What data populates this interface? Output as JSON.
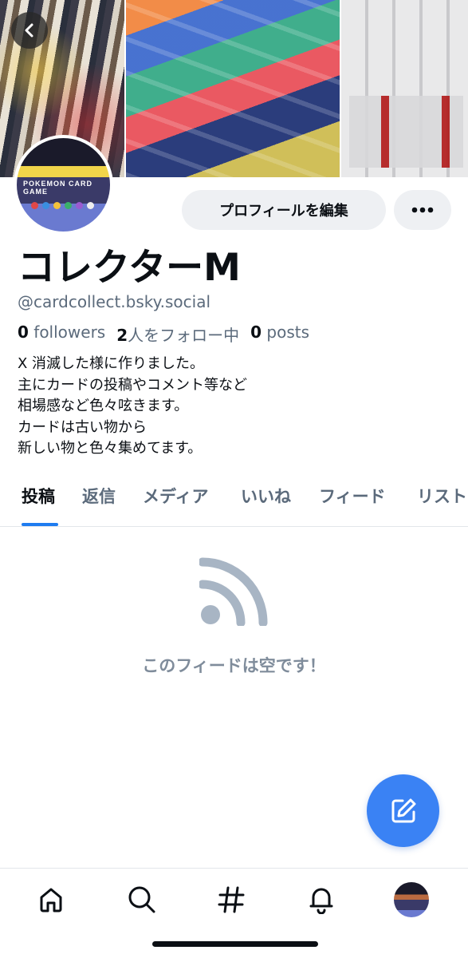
{
  "banner": {
    "alt": "collection banner"
  },
  "profile": {
    "display_name": "コレクターM",
    "handle": "@cardcollect.bsky.social",
    "avatar_text": "POKEMON CARD GAME",
    "followers_count": "0",
    "followers_label": "followers",
    "following_count": "2",
    "following_label": "人をフォロー中",
    "posts_count": "0",
    "posts_label": "posts",
    "bio_lines": [
      "X 消滅した様に作りました。",
      "主にカードの投稿やコメント等など",
      "相場感など色々呟きます。",
      "カードは古い物から",
      "新しい物と色々集めてます。"
    ]
  },
  "actions": {
    "edit_profile": "プロフィールを編集"
  },
  "tabs": [
    {
      "label": "投稿",
      "active": true
    },
    {
      "label": "返信",
      "active": false
    },
    {
      "label": "メディア",
      "active": false
    },
    {
      "label": "いいね",
      "active": false
    },
    {
      "label": "フィード",
      "active": false
    },
    {
      "label": "リスト",
      "active": false
    }
  ],
  "empty_state": {
    "icon": "rss-feed-icon",
    "message": "このフィードは空です！"
  },
  "fab": {
    "icon": "compose-icon"
  },
  "bottom_nav": [
    {
      "icon": "home-icon"
    },
    {
      "icon": "search-icon"
    },
    {
      "icon": "hashtag-icon"
    },
    {
      "icon": "bell-icon"
    },
    {
      "icon": "profile-avatar"
    }
  ],
  "colors": {
    "accent": "#1f7cf0",
    "fab": "#3a82f4",
    "muted_text": "#5b6a7b",
    "empty_icon": "#a8b5c4",
    "button_bg": "#eef0f3"
  }
}
